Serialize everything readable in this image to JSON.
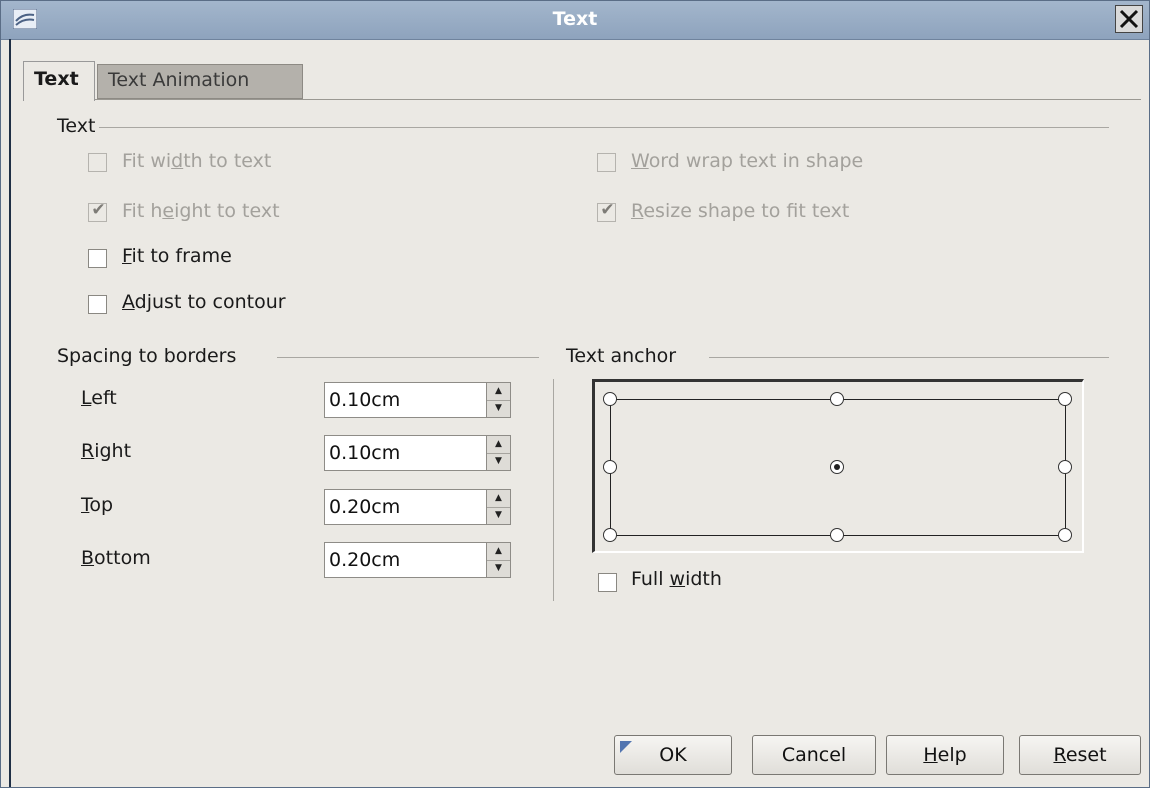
{
  "window": {
    "title": "Text"
  },
  "tabs": [
    {
      "label": "Text",
      "active": true
    },
    {
      "label": "Text Animation",
      "active": false
    }
  ],
  "text_group": {
    "title": "Text",
    "fit_width": {
      "pre": "Fit wi",
      "u": "d",
      "post": "th to text",
      "checked": false,
      "enabled": false
    },
    "fit_height": {
      "pre": "Fit h",
      "u": "e",
      "post": "ight to text",
      "checked": true,
      "enabled": false
    },
    "fit_frame": {
      "pre": "",
      "u": "F",
      "post": "it to frame",
      "checked": false,
      "enabled": true
    },
    "adjust_contour": {
      "pre": "",
      "u": "A",
      "post": "djust to contour",
      "checked": false,
      "enabled": true
    },
    "word_wrap": {
      "pre": "",
      "u": "W",
      "post": "ord wrap text in shape",
      "checked": false,
      "enabled": false
    },
    "resize_shape": {
      "pre": "",
      "u": "R",
      "post": "esize shape to fit text",
      "checked": true,
      "enabled": false
    }
  },
  "spacing_group": {
    "title": "Spacing to borders",
    "left": {
      "u": "L",
      "post": "eft",
      "value": "0.10cm"
    },
    "right": {
      "u": "R",
      "post": "ight",
      "value": "0.10cm"
    },
    "top": {
      "u": "T",
      "post": "op",
      "value": "0.20cm"
    },
    "bottom": {
      "u": "B",
      "post": "ottom",
      "value": "0.20cm"
    }
  },
  "anchor_group": {
    "title": "Text anchor",
    "selected": "center",
    "full_width": {
      "pre": "Full ",
      "u": "w",
      "post": "idth",
      "checked": false
    }
  },
  "buttons": {
    "ok": "OK",
    "cancel": "Cancel",
    "help": {
      "u": "H",
      "post": "elp"
    },
    "reset": {
      "u": "R",
      "post": "eset"
    }
  },
  "icons": {
    "close": "close-icon",
    "check": "checkmark-icon",
    "spin_up": "arrow-up-icon",
    "spin_down": "arrow-down-icon",
    "app": "app-logo-icon"
  }
}
